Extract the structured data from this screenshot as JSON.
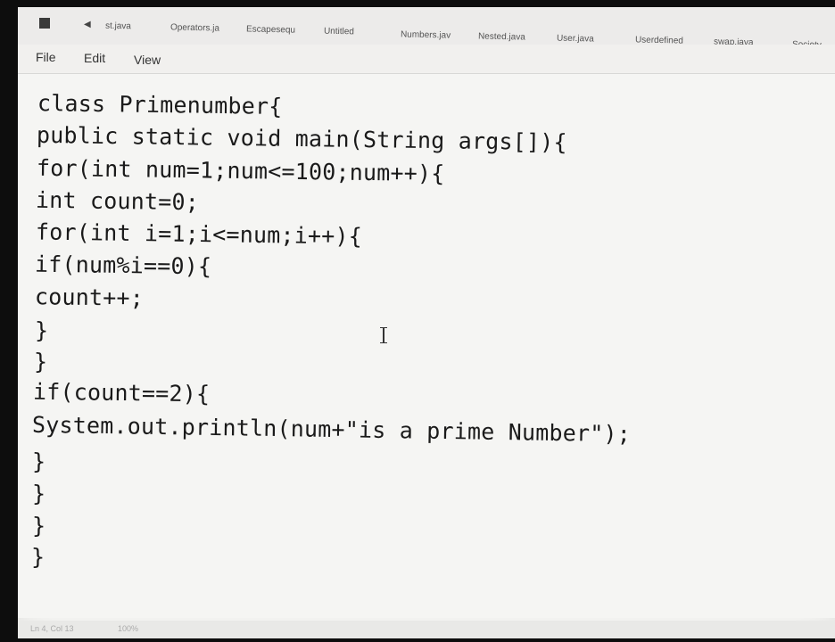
{
  "tabs": [
    {
      "label": "st.java"
    },
    {
      "label": "Operators.ja"
    },
    {
      "label": "Escapesequ"
    },
    {
      "label": "Untitled"
    },
    {
      "label": "Numbers.jav"
    },
    {
      "label": "Nested.java"
    },
    {
      "label": "User.java"
    },
    {
      "label": "Userdefined"
    },
    {
      "label": "swap.java"
    },
    {
      "label": "Society."
    }
  ],
  "menu": {
    "file": "File",
    "edit": "Edit",
    "view": "View"
  },
  "code_lines": [
    "class Primenumber{",
    "public static void main(String args[]){",
    "for(int num=1;num<=100;num++){",
    "int count=0;",
    "for(int i=1;i<=num;i++){",
    "if(num%i==0){",
    "count++;",
    "}",
    "}",
    "if(count==2){",
    "System.out.println(num+\"is a prime Number\");",
    "}",
    "}",
    "}",
    "}"
  ],
  "status": {
    "position": "Ln 4, Col 13",
    "zoom": "100%"
  }
}
